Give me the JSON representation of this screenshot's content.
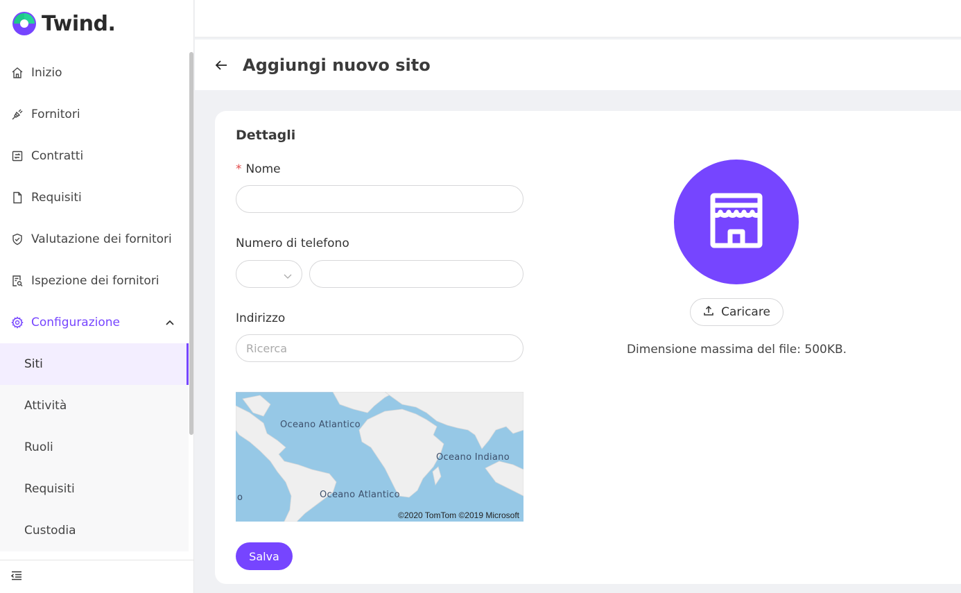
{
  "app": {
    "logo_text": "Twind.",
    "brand_color": "#7645ff"
  },
  "sidebar": {
    "items": [
      {
        "label": "Inizio",
        "icon": "home-icon"
      },
      {
        "label": "Fornitori",
        "icon": "plug-icon"
      },
      {
        "label": "Contratti",
        "icon": "contract-icon"
      },
      {
        "label": "Requisiti",
        "icon": "document-icon"
      },
      {
        "label": "Valutazione dei fornitori",
        "icon": "shield-check-icon"
      },
      {
        "label": "Ispezione dei fornitori",
        "icon": "inspection-icon"
      },
      {
        "label": "Configurazione",
        "icon": "gear-icon",
        "expanded": true
      }
    ],
    "sub_items": [
      {
        "label": "Siti",
        "selected": true
      },
      {
        "label": "Attività"
      },
      {
        "label": "Ruoli"
      },
      {
        "label": "Requisiti"
      },
      {
        "label": "Custodia"
      }
    ],
    "footer_icon": "collapse-menu-icon"
  },
  "header": {
    "title": "Aggiungi nuovo sito",
    "back_icon": "arrow-left-icon"
  },
  "form": {
    "section_title": "Dettagli",
    "name_label": "Nome",
    "name_required_mark": "*",
    "name_value": "",
    "phone_label": "Numero di telefono",
    "phone_prefix_value": "",
    "phone_value": "",
    "address_label": "Indirizzo",
    "address_placeholder": "Ricerca",
    "map": {
      "labels": [
        "Oceano Atlantico",
        "Oceano Indiano",
        "Oceano Atlantico",
        "o"
      ],
      "copyright": "©2020 TomTom ©2019 Microsoft"
    },
    "save_label": "Salva"
  },
  "image_upload": {
    "placeholder_icon": "store-icon",
    "upload_label": "Caricare",
    "upload_icon": "upload-icon",
    "hint": "Dimensione massima del file: 500KB."
  }
}
